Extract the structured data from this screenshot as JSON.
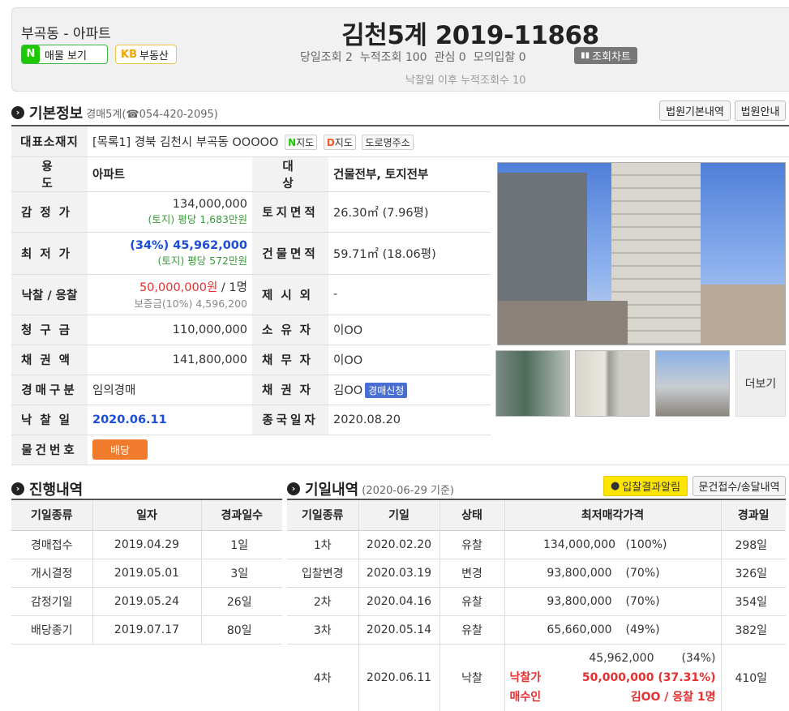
{
  "header": {
    "location": "부곡동 - 아파트",
    "naver_btn": "매물 보기",
    "kb_btn": "부동산",
    "case_title": "김천5계 2019-11868",
    "stats": [
      "당일조회 2",
      "누적조회 100",
      "관심 0",
      "모의입찰 0"
    ],
    "chart_btn": "조회차트",
    "after_views": "낙찰일 이후 누적조회수 10"
  },
  "basic": {
    "section_title": "기본정보",
    "court": "경매5계(☎054-420-2095)",
    "btn_court_info": "법원기본내역",
    "btn_court_guide": "법원안내",
    "addr_label": "대표소재지",
    "address": "[목록1] 경북 김천시 부곡동 OOOOO",
    "map_naver": "지도",
    "map_daum": "지도",
    "road_addr": "도로명주소",
    "use_label": "용도",
    "use": "아파트",
    "target_label": "대상",
    "target": "건물전부, 토지전부",
    "appraisal_label": "감정가",
    "appraisal": "134,000,000",
    "appraisal_sub": "(토지) 평당 1,683만원",
    "land_label": "토지면적",
    "land_area": "26.30㎡ (7.96평)",
    "min_label": "최저가",
    "min_price": "(34%) 45,962,000",
    "min_sub": "(토지) 평당 572만원",
    "bldg_label": "건물면적",
    "bldg_area": "59.71㎡ (18.06평)",
    "win_label": "낙찰 / 응찰",
    "win_price": "50,000,000원",
    "win_count": " / 1명",
    "deposit": "보증금(10%) 4,596,200",
    "excl_label": "제시외",
    "excl": "-",
    "claim_label": "청구금",
    "claim": "110,000,000",
    "owner_label": "소유자",
    "owner": "이OO",
    "debt_label": "채권액",
    "debt": "141,800,000",
    "debtor_label": "채무자",
    "debtor": "이OO",
    "type_label": "경매구분",
    "type": "임의경매",
    "creditor_label": "채권자",
    "creditor": "김OO",
    "creditor_badge": "경매신청",
    "sold_label": "낙찰일",
    "sold_date": "2020.06.11",
    "end_label": "종국일자",
    "end_date": "2020.08.20",
    "item_label": "물건번호",
    "item_btn": "배당",
    "more": "더보기"
  },
  "progress": {
    "section_title": "진행내역",
    "headers": [
      "기일종류",
      "일자",
      "경과일수"
    ],
    "rows": [
      [
        "경매접수",
        "2019.04.29",
        "1일"
      ],
      [
        "개시결정",
        "2019.05.01",
        "3일"
      ],
      [
        "감정기일",
        "2019.05.24",
        "26일"
      ],
      [
        "배당종기",
        "2019.07.17",
        "80일"
      ]
    ]
  },
  "dates": {
    "section_title": "기일내역",
    "as_of": "(2020-06-29 기준)",
    "kakao_btn": "입찰결과알림",
    "doc_btn": "문건접수/송달내역",
    "headers": [
      "기일종류",
      "기일",
      "상태",
      "최저매각가격",
      "경과일"
    ],
    "rows": [
      {
        "kind": "1차",
        "date": "2020.02.20",
        "status": "유찰",
        "price": "134,000,000",
        "pct": "(100%)",
        "days": "298일"
      },
      {
        "kind": "입찰변경",
        "date": "2020.03.19",
        "status": "변경",
        "price": "93,800,000",
        "pct": "(70%)",
        "days": "326일"
      },
      {
        "kind": "2차",
        "date": "2020.04.16",
        "status": "유찰",
        "price": "93,800,000",
        "pct": "(70%)",
        "days": "354일"
      },
      {
        "kind": "3차",
        "date": "2020.05.14",
        "status": "유찰",
        "price": "65,660,000",
        "pct": "(49%)",
        "days": "382일"
      }
    ],
    "last": {
      "kind": "4차",
      "date": "2020.06.11",
      "status": "낙찰",
      "price": "45,962,000",
      "pct": "(34%)",
      "win_label": "낙찰가",
      "win_price": "50,000,000",
      "win_pct": "(37.31%)",
      "buyer_label": "매수인",
      "buyer": "김OO / 응찰 1명",
      "days": "410일"
    }
  },
  "colors": {
    "accent_blue": "#1a4dd8",
    "red": "#e53030",
    "green": "#3a9b3a",
    "orange": "#f07b2c",
    "kakao": "#fee500"
  }
}
